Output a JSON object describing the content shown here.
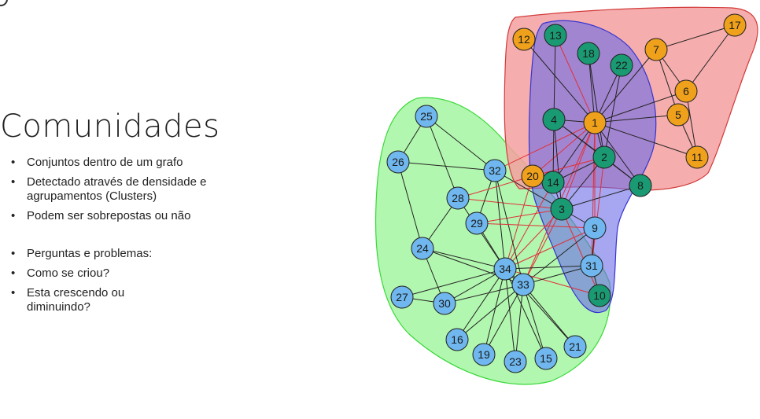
{
  "slide": {
    "title": "Comunidades",
    "bullets": [
      "Conjuntos dentro de um grafo",
      "Detectado através de densidade e agrupamentos (Clusters)",
      "Podem ser sobrepostas ou não",
      "Perguntas e problemas:",
      "Como se criou?",
      "Esta crescendo ou diminuindo?"
    ]
  },
  "graph": {
    "colors": {
      "green_community": "#9ff59b",
      "red_community": "#f4a3a3",
      "blue_community": "#8f8ff2",
      "node_blue": "#6fb7ee",
      "node_green": "#1a9a72",
      "node_orange": "#f0a11c",
      "edge_black": "#222222",
      "edge_red": "#e0303a"
    },
    "nodes": [
      {
        "id": "1",
        "color": "orange"
      },
      {
        "id": "2",
        "color": "green"
      },
      {
        "id": "3",
        "color": "green"
      },
      {
        "id": "4",
        "color": "green"
      },
      {
        "id": "5",
        "color": "orange"
      },
      {
        "id": "6",
        "color": "orange"
      },
      {
        "id": "7",
        "color": "orange"
      },
      {
        "id": "8",
        "color": "green"
      },
      {
        "id": "9",
        "color": "blue"
      },
      {
        "id": "10",
        "color": "green"
      },
      {
        "id": "11",
        "color": "orange"
      },
      {
        "id": "12",
        "color": "orange"
      },
      {
        "id": "13",
        "color": "green"
      },
      {
        "id": "14",
        "color": "green"
      },
      {
        "id": "15",
        "color": "blue"
      },
      {
        "id": "16",
        "color": "blue"
      },
      {
        "id": "17",
        "color": "orange"
      },
      {
        "id": "18",
        "color": "green"
      },
      {
        "id": "19",
        "color": "blue"
      },
      {
        "id": "20",
        "color": "orange"
      },
      {
        "id": "21",
        "color": "blue"
      },
      {
        "id": "22",
        "color": "green"
      },
      {
        "id": "23",
        "color": "blue"
      },
      {
        "id": "24",
        "color": "blue"
      },
      {
        "id": "25",
        "color": "blue"
      },
      {
        "id": "26",
        "color": "blue"
      },
      {
        "id": "27",
        "color": "blue"
      },
      {
        "id": "28",
        "color": "blue"
      },
      {
        "id": "29",
        "color": "blue"
      },
      {
        "id": "30",
        "color": "blue"
      },
      {
        "id": "31",
        "color": "blue"
      },
      {
        "id": "32",
        "color": "blue"
      },
      {
        "id": "33",
        "color": "blue"
      },
      {
        "id": "34",
        "color": "blue"
      }
    ]
  }
}
